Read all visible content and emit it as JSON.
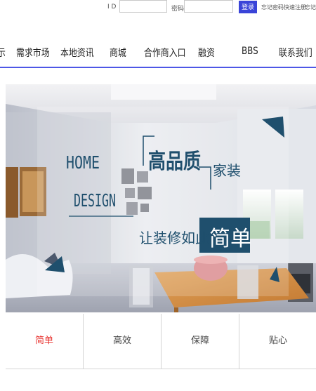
{
  "login": {
    "id_label": "I D",
    "password_label": "密码",
    "login_button": "登录",
    "forgot_password": "忘记密码",
    "quick_register": "快速注册",
    "ending_link": "忘记"
  },
  "nav": {
    "partial_item": "示",
    "items": [
      "需求市场",
      "本地资讯",
      "商城",
      "合作商入口",
      "融资",
      "BBS",
      "联系我们"
    ]
  },
  "banner": {
    "home": "HOME",
    "design": "DESIGN",
    "quality": "高品质",
    "home_decor": "家装",
    "tagline": "让装修如此",
    "simple": "简单",
    "accent_color": "#1f4f6d"
  },
  "features": [
    {
      "label": "简单",
      "active": true
    },
    {
      "label": "高效",
      "active": false
    },
    {
      "label": "保障",
      "active": false
    },
    {
      "label": "贴心",
      "active": false
    }
  ],
  "colors": {
    "nav_rule": "#4d57e6",
    "login_button": "#3a44d8",
    "active_feature": "#e8332f"
  }
}
